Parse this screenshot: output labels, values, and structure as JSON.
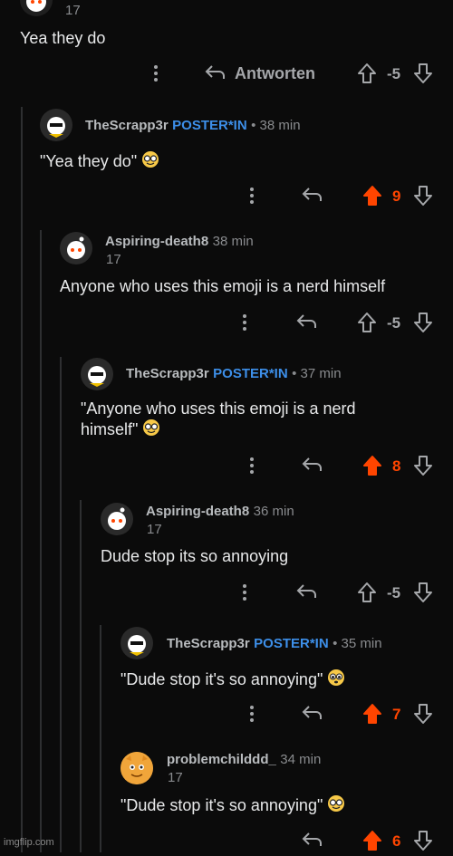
{
  "top_comment": {
    "sub": "17",
    "body": "Yea they do",
    "reply_label": "Antworten",
    "score": "-5"
  },
  "comments": [
    {
      "user": "TheScrapp3r",
      "flair": "POSTER*IN",
      "time": "• 38 min",
      "body": "\"Yea they do\"",
      "score": "9",
      "emoji": "nerd"
    },
    {
      "user": "Aspiring-death8",
      "time": "38 min",
      "sub": "17",
      "body": "Anyone who uses this emoji is a nerd himself",
      "score": "-5"
    },
    {
      "user": "TheScrapp3r",
      "flair": "POSTER*IN",
      "time": "• 37 min",
      "body1": "\"Anyone who uses this emoji is a nerd",
      "body2": "himself\"",
      "score": "8",
      "emoji": "nerd"
    },
    {
      "user": "Aspiring-death8",
      "time": "36 min",
      "sub": "17",
      "body": "Dude stop its so annoying",
      "score": "-5"
    },
    {
      "user": "TheScrapp3r",
      "flair": "POSTER*IN",
      "time": "• 35 min",
      "body": "\"Dude stop it's so annoying\"",
      "score": "7",
      "emoji": "pleading"
    },
    {
      "user": "problemchilddd_",
      "time": "34 min",
      "sub": "17",
      "body": "\"Dude stop it's so annoying\"",
      "score": "6",
      "emoji": "nerd"
    }
  ],
  "watermark": "imgflip.com",
  "colors": {
    "background": "#0b0b0b",
    "upvoted": "#ff4500",
    "flair": "#3d8fe9",
    "muted": "#898b8e"
  }
}
